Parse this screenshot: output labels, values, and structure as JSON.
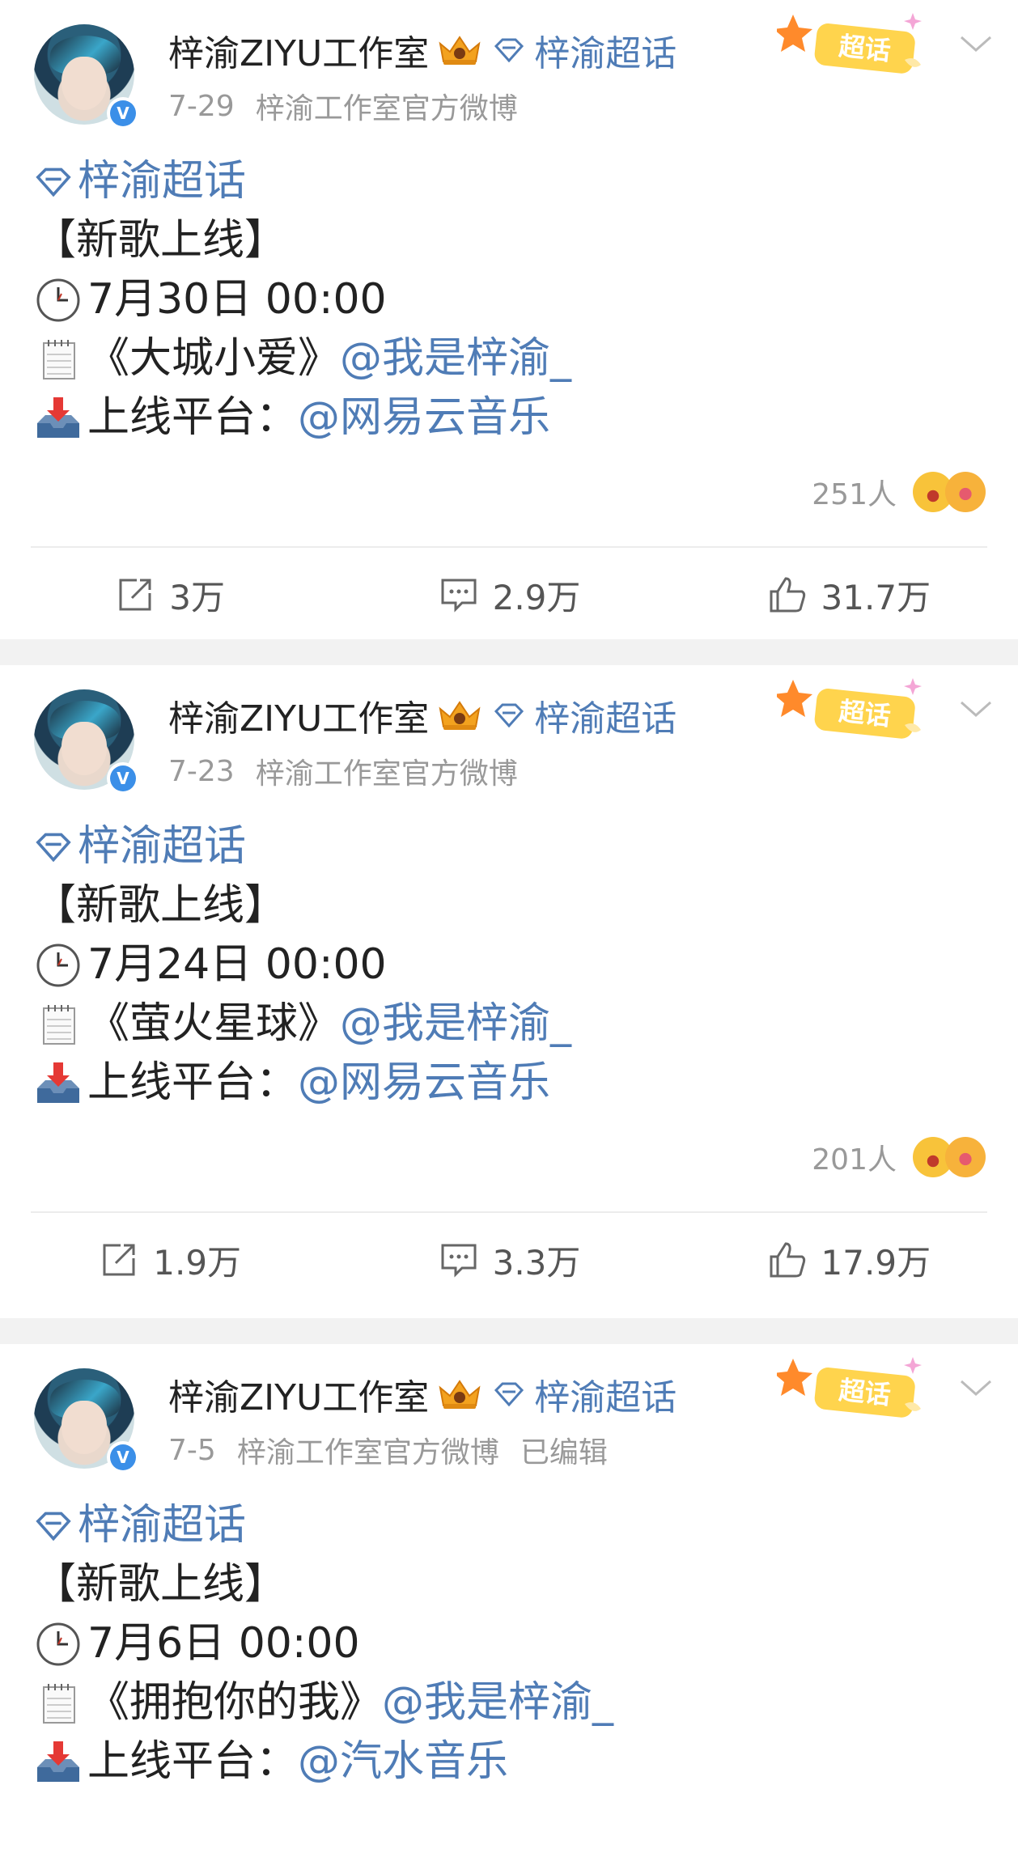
{
  "posts": [
    {
      "author": "梓渝ZIYU工作室",
      "topic_tag": "梓渝超话",
      "date": "7-29",
      "source": "梓渝工作室官方微博",
      "edited": "",
      "topic_link": "梓渝超话",
      "headline": "【新歌上线】",
      "time": "7月30日 00:00",
      "song": "《大城小爱》",
      "mention": "@我是梓渝_",
      "platform_label": "上线平台：",
      "platform": "@网易云音乐",
      "reactions": "251人",
      "reposts": "3万",
      "comments": "2.9万",
      "likes": "31.7万"
    },
    {
      "author": "梓渝ZIYU工作室",
      "topic_tag": "梓渝超话",
      "date": "7-23",
      "source": "梓渝工作室官方微博",
      "edited": "",
      "topic_link": "梓渝超话",
      "headline": "【新歌上线】",
      "time": "7月24日 00:00",
      "song": "《萤火星球》",
      "mention": "@我是梓渝_",
      "platform_label": "上线平台：",
      "platform": "@网易云音乐",
      "reactions": "201人",
      "reposts": "1.9万",
      "comments": "3.3万",
      "likes": "17.9万"
    },
    {
      "author": "梓渝ZIYU工作室",
      "topic_tag": "梓渝超话",
      "date": "7-5",
      "source": "梓渝工作室官方微博",
      "edited": "已编辑",
      "topic_link": "梓渝超话",
      "headline": "【新歌上线】",
      "time": "7月6日 00:00",
      "song": "《拥抱你的我》",
      "mention": "@我是梓渝_",
      "platform_label": "上线平台：",
      "platform": "@汽水音乐",
      "reactions": "",
      "reposts": "",
      "comments": "",
      "likes": ""
    }
  ],
  "badge_label": "超话",
  "verified_mark": "V",
  "colors": {
    "link": "#4f7cb6",
    "meta": "#999999",
    "separator": "#f2f2f2",
    "badge": "#ffd44d"
  }
}
